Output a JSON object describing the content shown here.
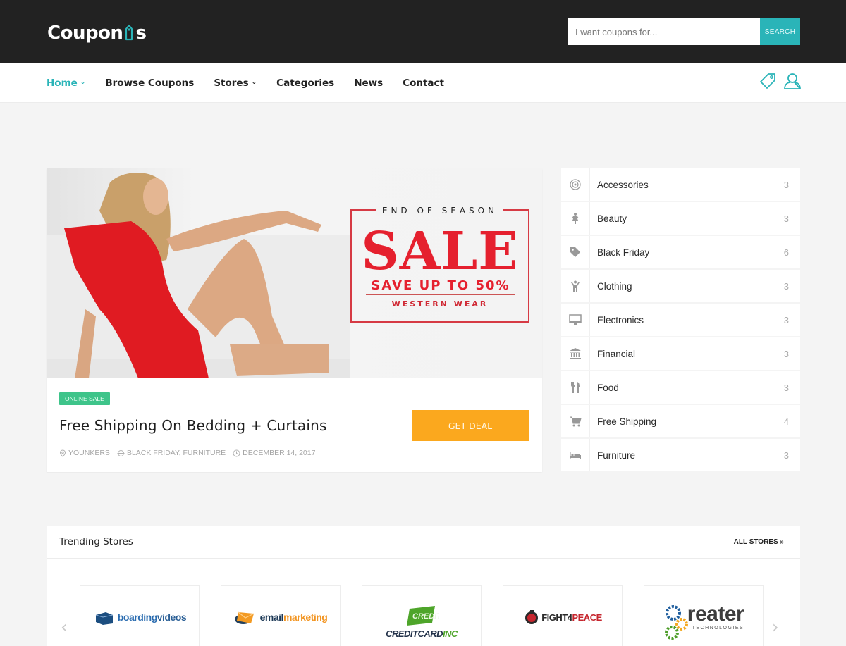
{
  "header": {
    "logo_text": "Coupon",
    "logo_suffix": "s",
    "search_placeholder": "I want coupons for...",
    "search_button": "SEARCH"
  },
  "nav": {
    "items": [
      {
        "label": "Home",
        "has_dropdown": true,
        "active": true
      },
      {
        "label": "Browse Coupons",
        "has_dropdown": false
      },
      {
        "label": "Stores",
        "has_dropdown": true
      },
      {
        "label": "Categories",
        "has_dropdown": false
      },
      {
        "label": "News",
        "has_dropdown": false
      },
      {
        "label": "Contact",
        "has_dropdown": false
      }
    ],
    "icons": [
      "tag-icon",
      "user-icon"
    ],
    "accent_color": "#2ab4b8"
  },
  "feature": {
    "banner": {
      "top_line": "END OF SEASON",
      "headline": "SALE",
      "subline": "SAVE UP TO 50%",
      "category": "WESTERN WEAR"
    },
    "badge": "ONLINE SALE",
    "title": "Free Shipping On Bedding + Curtains",
    "button": "GET DEAL",
    "meta": {
      "store": "YOUNKERS",
      "categories": "BLACK FRIDAY, FURNITURE",
      "date": "DECEMBER 14, 2017"
    }
  },
  "categories": [
    {
      "icon": "target-icon",
      "label": "Accessories",
      "count": "3"
    },
    {
      "icon": "woman-icon",
      "label": "Beauty",
      "count": "3"
    },
    {
      "icon": "tag-icon",
      "label": "Black Friday",
      "count": "6"
    },
    {
      "icon": "child-icon",
      "label": "Clothing",
      "count": "3"
    },
    {
      "icon": "desktop-icon",
      "label": "Electronics",
      "count": "3"
    },
    {
      "icon": "bank-icon",
      "label": "Financial",
      "count": "3"
    },
    {
      "icon": "cutlery-icon",
      "label": "Food",
      "count": "3"
    },
    {
      "icon": "cart-icon",
      "label": "Free Shipping",
      "count": "4"
    },
    {
      "icon": "bed-icon",
      "label": "Furniture",
      "count": "3"
    }
  ],
  "trending": {
    "title": "Trending Stores",
    "all_link": "ALL STORES »",
    "stores": [
      {
        "name_a": "boarding",
        "name_b": "videos"
      },
      {
        "name_a": "email",
        "name_b": "marketing"
      },
      {
        "name_a": "CREDITCARD",
        "name_b": "INC"
      },
      {
        "name_a": "FIGHT4",
        "name_b": "PEACE"
      },
      {
        "name_a": "reater",
        "name_b": "TECHNOLOGIES"
      }
    ],
    "prev": "‹",
    "next": "›"
  }
}
